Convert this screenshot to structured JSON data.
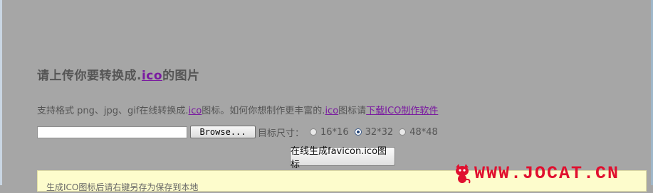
{
  "heading": {
    "prefix": "请上传你要转换成.",
    "link": "ico",
    "suffix": "的图片"
  },
  "desc": {
    "part1": "支持格式 png、jpg、gif在线转换成.",
    "link1": "ico",
    "part2": "图标。如何你想制作更丰富的.",
    "link2": "ico",
    "part3": "图标请",
    "link3": "下载ICO制作软件"
  },
  "upload": {
    "browse_label": "Browse...",
    "size_label": "目标尺寸：",
    "options": [
      {
        "label": "16*16",
        "checked": false
      },
      {
        "label": "32*32",
        "checked": true
      },
      {
        "label": "48*48",
        "checked": false
      }
    ]
  },
  "generate_button": "在线生成favicon.ico图标",
  "notice": {
    "text": "生成ICO图标后请右键另存为保存到本地"
  },
  "watermark": {
    "text": "WWW.JOCAT.CN",
    "color": "#e0102f"
  }
}
